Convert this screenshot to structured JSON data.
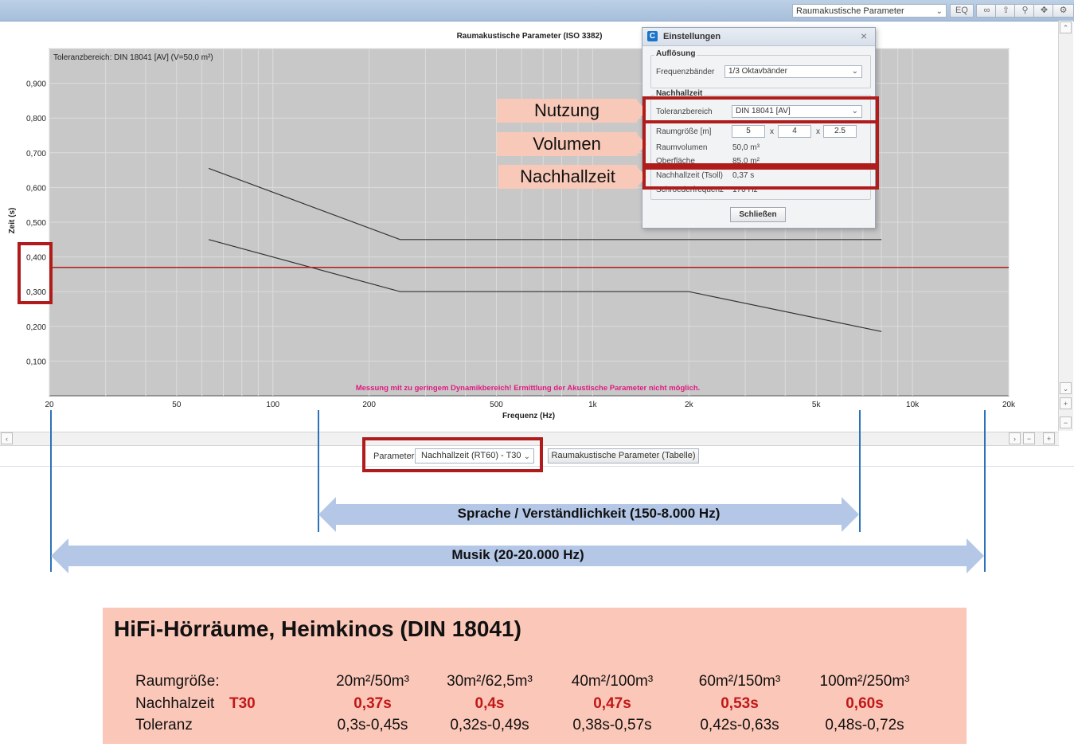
{
  "toolbar": {
    "view_select": "Raumakustische Parameter",
    "eq_label": "EQ",
    "icons": [
      "link-icon",
      "upload-icon",
      "zoom-icon",
      "move-icon",
      "gear-icon"
    ]
  },
  "chart": {
    "title": "Raumakustische Parameter (ISO 3382)",
    "tolerance_note": "Toleranzbereich: DIN 18041 [AV] (V=50,0 m²)",
    "warning": "Messung mit zu geringem Dynamikbereich! Ermittlung der Akustische Parameter nicht möglich.",
    "ylabel": "Zeit (s)",
    "xlabel": "Frequenz (Hz)",
    "yticks": [
      "0,900",
      "0,800",
      "0,700",
      "0,600",
      "0,500",
      "0,400",
      "0,300",
      "0,200",
      "0,100"
    ],
    "xticks": [
      "20",
      "50",
      "100",
      "200",
      "500",
      "1k",
      "2k",
      "5k",
      "10k",
      "20k"
    ]
  },
  "chart_data": {
    "type": "line",
    "title": "Raumakustische Parameter (ISO 3382)",
    "xlabel": "Frequenz (Hz)",
    "ylabel": "Zeit (s)",
    "x_scale": "log",
    "xlim": [
      20,
      20000
    ],
    "ylim": [
      0,
      1.0
    ],
    "grid": true,
    "series": [
      {
        "x": [
          63,
          250,
          8000
        ],
        "y": [
          0.655,
          0.45,
          0.45
        ]
      },
      {
        "x": [
          63,
          250,
          2000,
          8000
        ],
        "y": [
          0.45,
          0.3,
          0.3,
          0.185
        ]
      },
      {
        "x": [
          20,
          20000
        ],
        "y": [
          0.37,
          0.37
        ]
      }
    ]
  },
  "params": {
    "label": "Parameter",
    "selected": "Nachhallzeit (RT60) - T30",
    "table_button": "Raumakustische Parameter (Tabelle)"
  },
  "dialog": {
    "title": "Einstellungen",
    "group_resolution": "Auflösung",
    "freq_label": "Frequenzbänder",
    "freq_value": "1/3 Oktavbänder",
    "group_reverb": "Nachhallzeit",
    "tolerance_label": "Toleranzbereich",
    "tolerance_value": "DIN 18041 [AV]",
    "roomsize_label": "Raumgröße [m]",
    "dim_x": "5",
    "dim_y": "4",
    "dim_z": "2.5",
    "times": "x",
    "volume_label": "Raumvolumen",
    "volume_value": "50,0 m³",
    "surface_label": "Oberfläche",
    "surface_value": "85,0 m²",
    "reverb_label": "Nachhallzeit (Tsoll)",
    "reverb_value": "0,37 s",
    "schroeder_label": "Schroederfrequenz",
    "schroeder_value": "170 Hz",
    "close_button": "Schließen"
  },
  "callouts": {
    "nutzung": "Nutzung",
    "volumen": "Volumen",
    "nachhallzeit": "Nachhallzeit"
  },
  "ranges": {
    "speech": "Sprache / Verständlichkeit (150-8.000 Hz)",
    "music": "Musik (20-20.000 Hz)"
  },
  "info": {
    "title": "HiFi-Hörräume, Heimkinos  (DIN 18041)",
    "row_size_label": "Raumgröße:",
    "row_reverb_label": "Nachhalzeit",
    "row_reverb_tag": "T30",
    "row_tol_label": "Toleranz",
    "sizes": [
      "20m²/50m³",
      "30m²/62,5m³",
      "40m²/100m³",
      "60m²/150m³",
      "100m²/250m³"
    ],
    "reverbs": [
      "0,37s",
      "0,4s",
      "0,47s",
      "0,53s",
      "0,60s"
    ],
    "tolerances": [
      "0,3s-0,45s",
      "0,32s-0,49s",
      "0,38s-0,57s",
      "0,42s-0,63s",
      "0,48s-0,72s"
    ]
  },
  "colors": {
    "accent_red": "#b01c1c",
    "target_line": "#b01c1c",
    "range_arrow": "#b4c7e7",
    "marker_blue": "#2b72b8",
    "panel_bg": "#fbc7b8"
  }
}
